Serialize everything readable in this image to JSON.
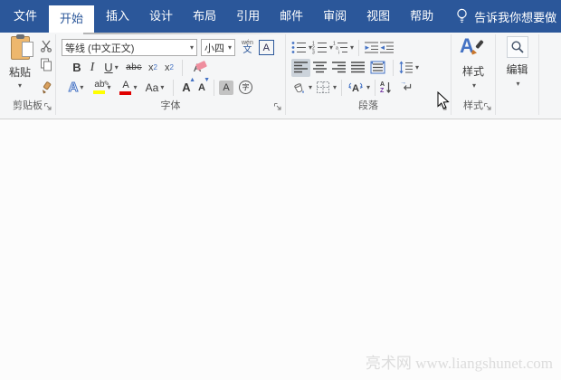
{
  "titlebar": {
    "tabs": [
      {
        "label": "文件"
      },
      {
        "label": "开始"
      },
      {
        "label": "插入"
      },
      {
        "label": "设计"
      },
      {
        "label": "布局"
      },
      {
        "label": "引用"
      },
      {
        "label": "邮件"
      },
      {
        "label": "审阅"
      },
      {
        "label": "视图"
      },
      {
        "label": "帮助"
      }
    ],
    "tellme_label": "告诉我你想要做"
  },
  "ribbon": {
    "clipboard": {
      "group_label": "剪贴板",
      "paste_label": "粘贴"
    },
    "font": {
      "group_label": "字体",
      "font_name_value": "等线 (中文正文)",
      "font_size_value": "小四",
      "phonetic_top": "wén",
      "phonetic_bottom": "文",
      "char_border_letter": "A",
      "bold": "B",
      "italic": "I",
      "underline": "U",
      "strikethrough": "abc",
      "sub_base": "x",
      "sub_digit": "2",
      "sup_base": "x",
      "sup_digit": "2",
      "clear_letter": "A",
      "effects_letter": "A",
      "highlight_letters": "ab",
      "color_letter": "A",
      "case_letters": "Aa",
      "grow_letter": "A",
      "shrink_letter": "A",
      "shade_letter": "A",
      "enclose_letter": "字"
    },
    "paragraph": {
      "group_label": "段落",
      "sort_top": "A",
      "sort_bottom": "Z",
      "show_hide_glyph": "↵",
      "asian_letter": "A"
    },
    "styles": {
      "group_label": "样式",
      "button_label": "样式"
    },
    "editing": {
      "button_label": "编辑"
    }
  },
  "watermark": "亮术网 www.liangshunet.com",
  "colors": {
    "accent_blue": "#2b579a",
    "icon_blue": "#4472c4",
    "highlight_yellow": "#ffff00",
    "font_color_red": "#e00000"
  }
}
